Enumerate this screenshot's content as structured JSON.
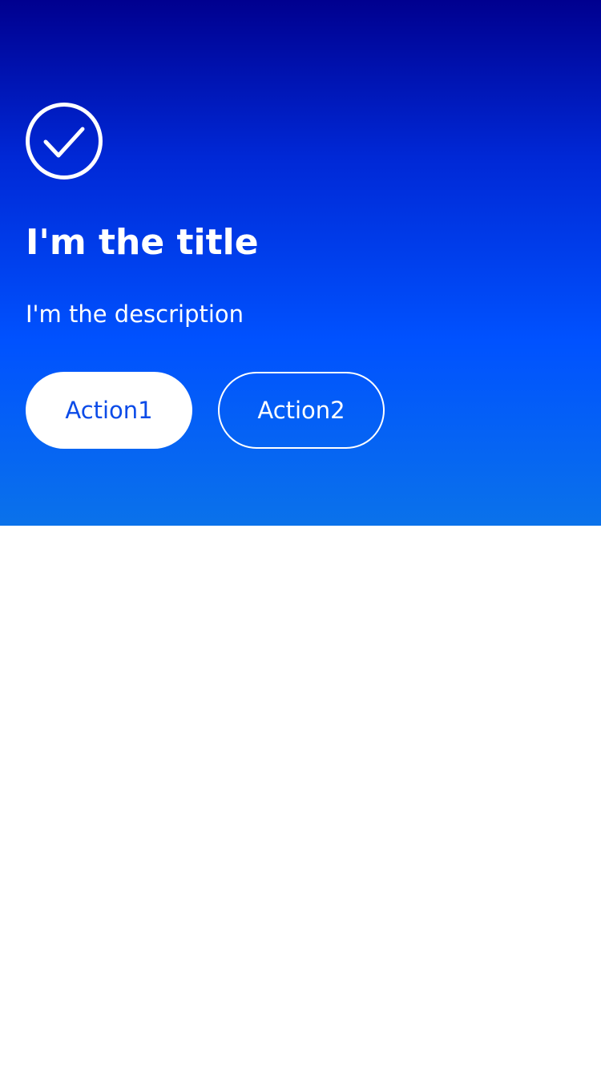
{
  "hero": {
    "icon": "check-circle-icon",
    "title": "I'm the title",
    "description": "I'm the description",
    "primary_action_label": "Action1",
    "secondary_action_label": "Action2"
  },
  "colors": {
    "gradient_top": "#00008f",
    "gradient_mid": "#0052ff",
    "gradient_bottom": "#0a72ea",
    "primary_button_text": "#0b4be8",
    "text_on_hero": "#ffffff",
    "page_background": "#ffffff"
  }
}
